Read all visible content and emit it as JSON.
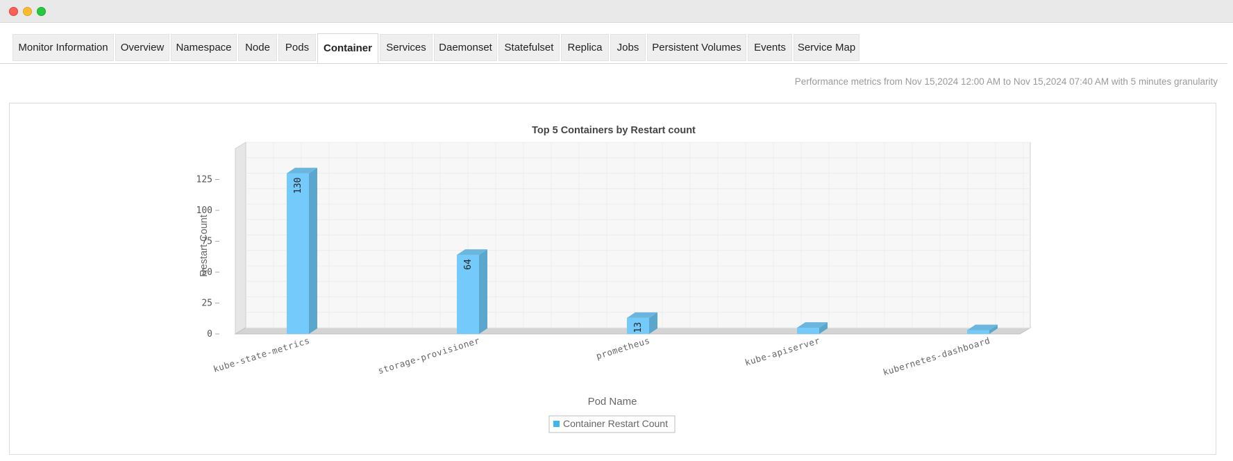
{
  "tabs": [
    {
      "label": "Monitor Information",
      "active": false
    },
    {
      "label": "Overview",
      "active": false
    },
    {
      "label": "Namespace",
      "active": false
    },
    {
      "label": "Node",
      "active": false
    },
    {
      "label": "Pods",
      "active": false
    },
    {
      "label": "Container",
      "active": true
    },
    {
      "label": "Services",
      "active": false
    },
    {
      "label": "Daemonset",
      "active": false
    },
    {
      "label": "Statefulset",
      "active": false
    },
    {
      "label": "Replica",
      "active": false
    },
    {
      "label": "Jobs",
      "active": false
    },
    {
      "label": "Persistent Volumes",
      "active": false
    },
    {
      "label": "Events",
      "active": false
    },
    {
      "label": "Service Map",
      "active": false
    }
  ],
  "performance_text": "Performance metrics from Nov 15,2024 12:00 AM to Nov 15,2024 07:40 AM with 5 minutes granularity",
  "chart_data": {
    "type": "bar",
    "title": "Top 5 Containers by Restart count",
    "xlabel": "Pod Name",
    "ylabel": "Restart Count",
    "categories": [
      "kube-state-metrics",
      "storage-provisioner",
      "prometheus",
      "kube-apiserver",
      "kubernetes-dashboard"
    ],
    "series": [
      {
        "name": "Container Restart Count",
        "values": [
          130,
          64,
          13,
          5,
          3
        ],
        "data_labels": [
          "130",
          "64",
          "13",
          "",
          ""
        ]
      }
    ],
    "ylim": [
      0,
      150
    ],
    "yticks": [
      0,
      25,
      50,
      75,
      100,
      125
    ],
    "grid": true,
    "legend": "bottom-center",
    "colors": {
      "bar_front": "#74cafa",
      "bar_side": "#5aa6cc",
      "bar_top": "#6bb6de",
      "legend_swatch": "#3fb4f0"
    }
  }
}
